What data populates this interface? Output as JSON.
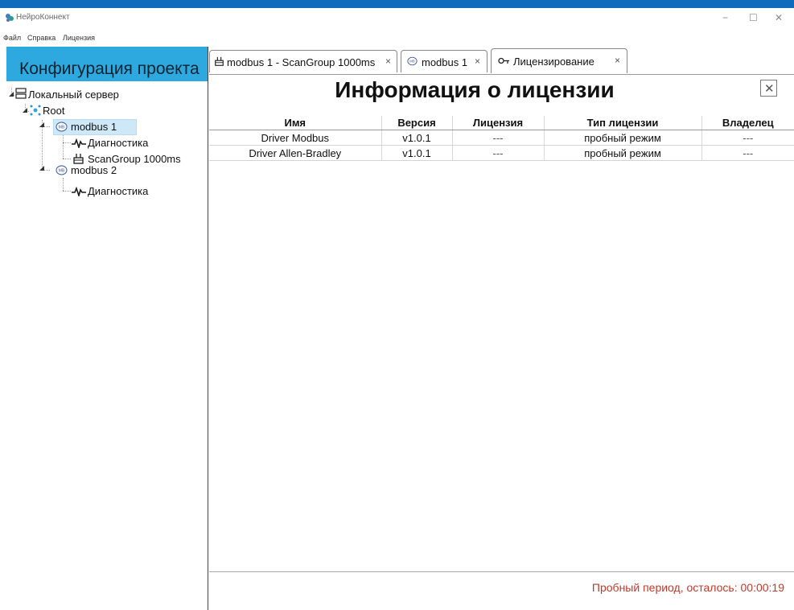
{
  "window": {
    "title": "НейроКоннект",
    "minimize": "−",
    "maximize": "☐",
    "close": "✕"
  },
  "menu": [
    "Файл",
    "Справка",
    "Лицензия"
  ],
  "left_panel": {
    "title": "Конфигурация проекта",
    "tree": {
      "server": "Локальный сервер",
      "root": "Root",
      "modbus1": "modbus 1",
      "modbus1_diag": "Диагностика",
      "modbus1_scan": "ScanGroup 1000ms",
      "modbus2": "modbus 2",
      "modbus2_diag": "Диагностика",
      "selected": "modbus 1"
    }
  },
  "tabs": [
    {
      "label": "modbus 1 - ScanGroup 1000ms",
      "icon": "scangroup-icon",
      "close": "×"
    },
    {
      "label": "modbus 1",
      "icon": "modbus-icon",
      "close": "×"
    },
    {
      "label": "Лицензирование",
      "icon": "key-icon",
      "close": "×",
      "active": true
    }
  ],
  "license_page": {
    "title": "Информация о лицензии",
    "close_symbol": "✕",
    "columns": [
      "Имя",
      "Версия",
      "Лицензия",
      "Тип лицензии",
      "Владелец"
    ],
    "rows": [
      [
        "Driver Modbus",
        "v1.0.1",
        "---",
        "пробный режим",
        "---"
      ],
      [
        "Driver Allen-Bradley",
        "v1.0.1",
        "---",
        "пробный режим",
        "---"
      ]
    ],
    "status": "Пробный период, осталось: 00:00:19"
  },
  "colors": {
    "accent": "#0f6cbd",
    "panel_header": "#2da9df",
    "selection": "#cfe8f8",
    "status_text": "#c0392b"
  }
}
